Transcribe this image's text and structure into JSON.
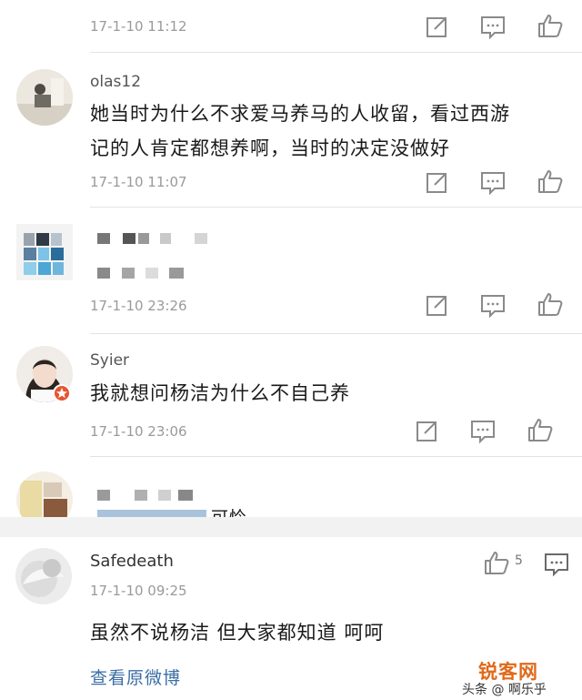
{
  "comments": [
    {
      "timestamp": "17-1-10 11:12"
    },
    {
      "username": "olas12",
      "text_line1": "她当时为什么不求爱马养马的人收留，看过西游",
      "text_line2": "记的人肯定都想养啊，当时的决定没做好",
      "timestamp": "17-1-10 11:07"
    },
    {
      "timestamp": "17-1-10 23:26"
    },
    {
      "username": "Syier",
      "text": "我就想问杨洁为什么不自己养",
      "timestamp": "17-1-10 23:06"
    },
    {
      "partial_text": "可怜"
    }
  ],
  "featured": {
    "username": "Safedeath",
    "timestamp": "17-1-10 09:25",
    "text": "虽然不说杨洁 但大家都知道 呵呵",
    "likes": "5",
    "view_original": "查看原微博"
  },
  "watermark": {
    "site": "锐客网",
    "source": "头条 @ 啊乐乎"
  },
  "icons": [
    "share-icon",
    "comment-icon",
    "like-icon"
  ]
}
